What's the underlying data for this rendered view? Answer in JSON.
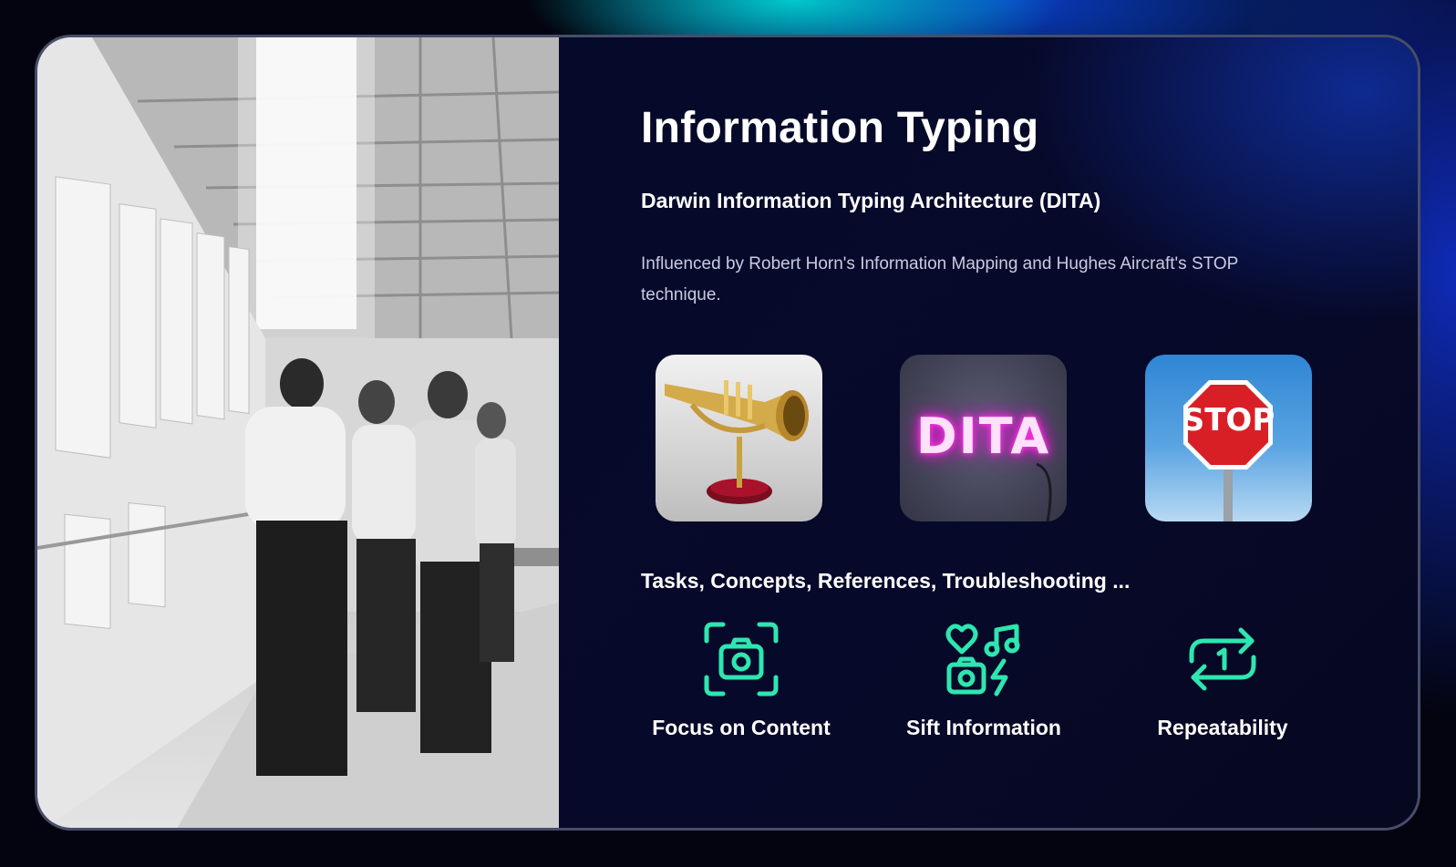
{
  "slide": {
    "title": "Information Typing",
    "subtitle": "Darwin Information Typing Architecture (DITA)",
    "description": "Influenced by Robert Horn's Information Mapping and Hughes Aircraft's STOP technique.",
    "images": [
      {
        "name": "trumpet-image",
        "label": ""
      },
      {
        "name": "dita-neon-sign",
        "label": "DITA"
      },
      {
        "name": "stop-sign",
        "label": "STOP"
      }
    ],
    "tasks_line": "Tasks, Concepts, References, Troubleshooting ...",
    "features": [
      {
        "icon": "camera-focus-icon",
        "label": "Focus on Content"
      },
      {
        "icon": "media-sift-icon",
        "label": "Sift Information"
      },
      {
        "icon": "repeat-one-icon",
        "label": "Repeatability"
      }
    ]
  },
  "colors": {
    "accent": "#2ee6b0",
    "panel_bg": "#070a26",
    "text": "#ffffff",
    "muted_text": "#c9cce0",
    "stop_red": "#d91f26"
  }
}
